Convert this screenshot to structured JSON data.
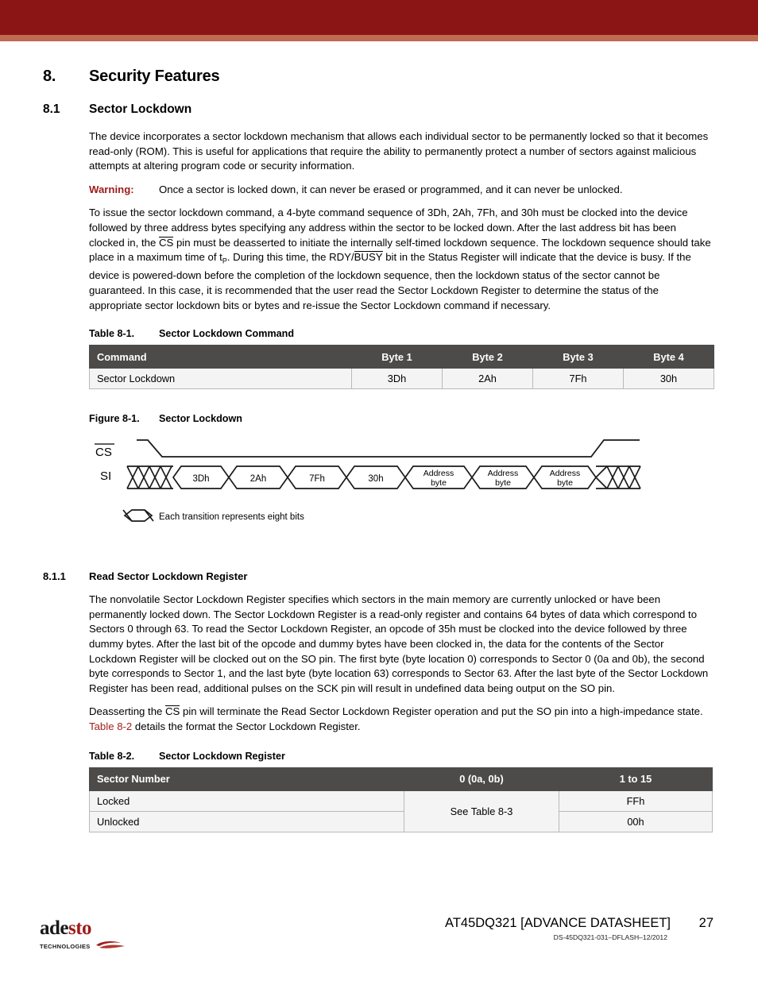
{
  "header": {
    "band_color_dark": "#8b1515",
    "band_color_light": "#c06a52"
  },
  "section": {
    "number": "8.",
    "title": "Security Features"
  },
  "subsection": {
    "number": "8.1",
    "title": "Sector Lockdown",
    "paragraph_1": "The device incorporates a sector lockdown mechanism that allows each individual sector to be permanently locked so that it becomes read-only (ROM). This is useful for applications that require the ability to permanently protect a number of sectors against malicious attempts at altering program code or security information.",
    "warning_label": "Warning:",
    "warning_text": "Once a sector is locked down, it can never be erased or programmed, and it can never be unlocked.",
    "warning_color": "#9e1b1b",
    "paragraph_2_a": "To issue the sector lockdown command, a 4-byte command sequence of 3Dh, 2Ah, 7Fh, and 30h must be clocked into the device followed by three address bytes specifying any address within the sector to be locked down. After the last address bit has been clocked in, the ",
    "paragraph_2_cs": "CS",
    "paragraph_2_b": " pin must be deasserted to initiate the internally self-timed lockdown sequence. The lockdown sequence should take place in a maximum time of t",
    "paragraph_2_sub": "P",
    "paragraph_2_c": ". During this time, the RDY/",
    "paragraph_2_busy": "BUSY",
    "paragraph_2_d": " bit in the Status Register will indicate that the device is busy. If the device is powered-down before the completion of the lockdown sequence, then the lockdown status of the sector cannot be guaranteed. In this case, it is recommended that the user read the Sector Lockdown Register to determine the status of the appropriate sector lockdown bits or bytes and re-issue the Sector Lockdown command if necessary."
  },
  "table_8_1": {
    "caption_number": "Table 8-1.",
    "caption_title": "Sector Lockdown Command",
    "headers": [
      "Command",
      "Byte 1",
      "Byte 2",
      "Byte 3",
      "Byte 4"
    ],
    "rows": [
      [
        "Sector Lockdown",
        "3Dh",
        "2Ah",
        "7Fh",
        "30h"
      ]
    ]
  },
  "figure_8_1": {
    "caption_number": "Figure 8-1.",
    "caption_title": "Sector Lockdown",
    "label_cs": "CS",
    "label_si": "SI",
    "si_cells": [
      "3Dh",
      "2Ah",
      "7Fh",
      "30h",
      "Address byte",
      "Address byte",
      "Address byte"
    ],
    "legend_text": "Each transition represents eight bits"
  },
  "subsubsection": {
    "number": "8.1.1",
    "title": "Read Sector Lockdown Register",
    "paragraph_1": "The nonvolatile Sector Lockdown Register specifies which sectors in the main memory are currently unlocked or have been permanently locked down. The Sector Lockdown Register is a read-only register and contains 64 bytes of data which correspond to Sectors 0 through 63. To read the Sector Lockdown Register, an opcode of 35h must be clocked into the device followed by three dummy bytes. After the last bit of the opcode and dummy bytes have been clocked in, the data for the contents of the Sector Lockdown Register will be clocked out on the SO pin. The first byte (byte location 0) corresponds to Sector 0 (0a and 0b), the second byte corresponds to Sector 1, and the last byte (byte location 63) corresponds to Sector 63. After the last byte of the Sector Lockdown Register has been read, additional pulses on the SCK pin will result in undefined data being output on the SO pin.",
    "paragraph_2_a": "Deasserting the ",
    "paragraph_2_cs": "CS",
    "paragraph_2_b": " pin will terminate the Read Sector Lockdown Register operation and put the SO pin into a high-impedance state. ",
    "paragraph_2_xref": "Table 8-2",
    "paragraph_2_c": " details the format the Sector Lockdown Register.",
    "xref_color": "#a42020"
  },
  "table_8_2": {
    "caption_number": "Table 8-2.",
    "caption_title": "Sector Lockdown Register",
    "headers": [
      "Sector Number",
      "0 (0a, 0b)",
      "1 to 15"
    ],
    "row_locked_label": "Locked",
    "row_locked_value": "FFh",
    "row_unlocked_label": "Unlocked",
    "row_unlocked_value": "00h",
    "merged_cell": "See Table 8-3"
  },
  "footer": {
    "logo_part1": "ade",
    "logo_part2": "sto",
    "logo_tagline": "TECHNOLOGIES",
    "doc_title": "AT45DQ321 [ADVANCE DATASHEET]",
    "page_number": "27",
    "doc_id": "DS-45DQ321-031–DFLASH–12/2012"
  }
}
